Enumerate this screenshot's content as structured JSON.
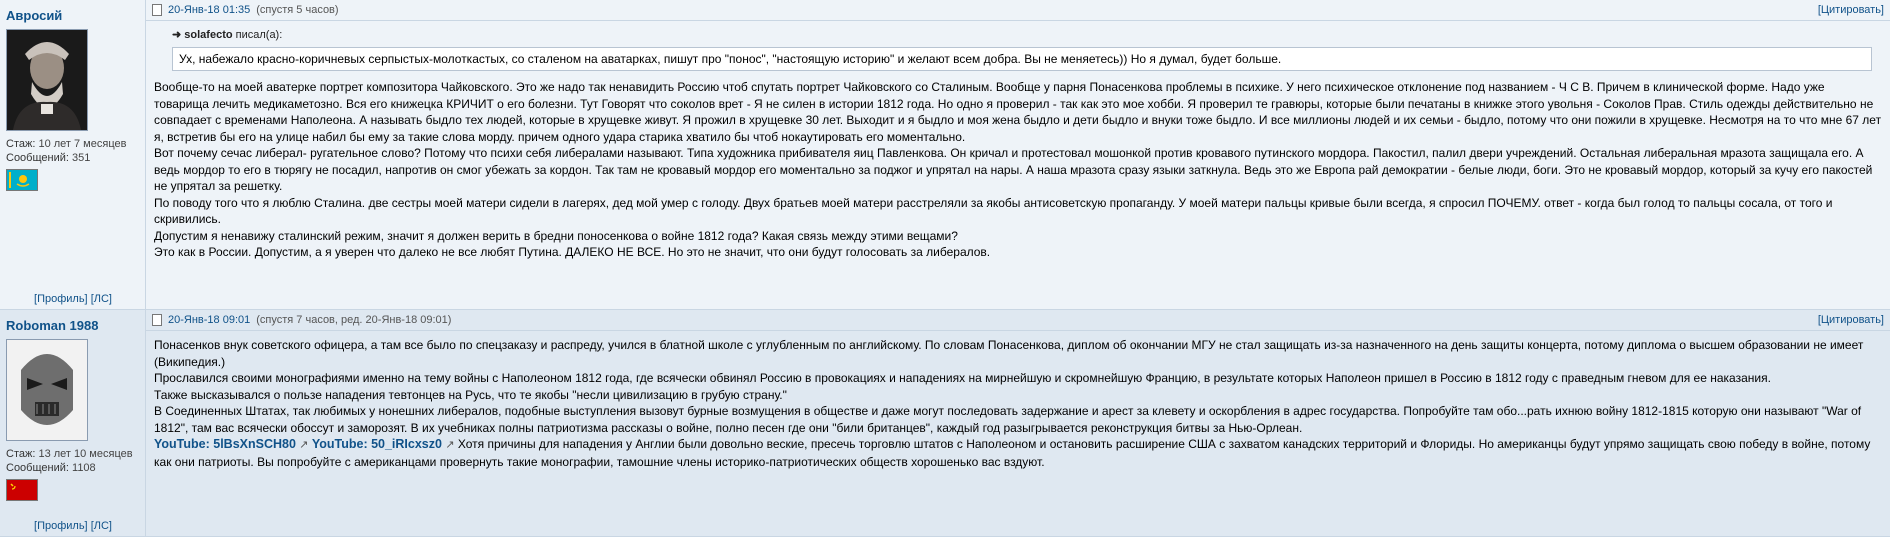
{
  "posts": [
    {
      "author": "Авросий",
      "stats": {
        "tenure_label": "Стаж:",
        "tenure": "10 лет 7 месяцев",
        "posts_label": "Сообщений:",
        "posts": "351"
      },
      "links": {
        "profile": "[Профиль]",
        "pm": "[ЛС]"
      },
      "date": "20-Янв-18 01:35",
      "since": "(спустя 5 часов)",
      "quote_button": "[Цитировать]",
      "quote": {
        "author": "solafecto",
        "verb": "писал(а):",
        "text": "Ух, набежало красно-коричневых серпыстых-молоткастых, со сталеном на аватарках, пишут про \"понос\", \"настоящую историю\" и желают всем добра. Вы не меняетесь)) Но я думал, будет больше."
      },
      "paragraphs": [
        "Вообще-то на моей аватерке портрет композитора Чайковского. Это же надо так ненавидить Россию чтоб спутать портрет Чайковского со Сталиным. Вообще у парня Понасенкова проблемы в психике. У него психическое отклонение под названием - Ч С В. Причем в клинической форме. Надо уже товарища лечить медикаметозно. Вся его книжецка КРИЧИТ о его болезни. Тут Говорят что соколов врет - Я не силен в истории 1812 года. Но одно я проверил - так как это мое хобби. Я проверил те гравюры, которые были печатаны в книжке этого увольня - Соколов Прав. Стиль одежды действительно не совпадает с временами Наполеона. А называть быдло тех людей, которые в хрущевке живут. Я прожил в хрущевке 30 лет. Выходит и я быдло и моя жена быдло и дети быдло и внуки тоже быдло. И все миллионы людей и их семьи - быдло, потому что они пожили в хрущевке. Несмотря на то что мне 67 лет я, встретив бы его на улице набил бы ему за такие слова морду. причем одного удара старика хватило бы чтоб нокаутировать его моментально.",
        "Вот почему сечас либерал- ругательное слово? Потому что психи себя либералами называют. Типа художника прибивателя яиц Павленкова. Он кричал и протестовал мошонкой против кровавого путинского мордора. Пакостил, палил двери учреждений. Остальная либеральная мразота защищала его. А ведь мордор то его в тюрягу не посадил, напротив он смог убежать за кордон. Так там не кровавый мордор его моментально за поджог и упрятал на нары. А наша мразота сразу языки заткнула. Ведь это же Европа рай демократии - белые люди, боги. Это не кровавый мордор, который за кучу его пакостей не упрятал за решетку.",
        "По поводу того что я люблю Сталина. две сестры моей матери сидели в лагерях, дед мой умер с голоду. Двух братьев моей матери расстреляли за якобы антисоветскую пропаганду. У моей матери пальцы кривые были всегда, я спросил ПОЧЕМУ. ответ - когда был голод то пальцы сосала, от того и скривились.",
        "Допустим я ненавижу сталинский режим, значит я должен верить в бредни поносенкова о войне 1812 года? Какая связь между этими вещами?",
        "Это как в России. Допустим, а я уверен что далеко не все любят Путина. ДАЛЕКО НЕ ВСЕ. Но это не значит, что они будут голосовать за либералов."
      ]
    },
    {
      "author": "Roboman 1988",
      "stats": {
        "tenure_label": "Стаж:",
        "tenure": "13 лет 10 месяцев",
        "posts_label": "Сообщений:",
        "posts": "1108"
      },
      "links": {
        "profile": "[Профиль]",
        "pm": "[ЛС]"
      },
      "date": "20-Янв-18 09:01",
      "since": "(спустя 7 часов, ред. 20-Янв-18 09:01)",
      "quote_button": "[Цитировать]",
      "paragraphs": [
        "Понасенков внук советского офицера, а там все было по спецзаказу и распреду, учился в блатной школе с углубленным по английскому. По словам Понасенкова, диплом об окончании МГУ не стал защищать из-за назначенного на день защиты концерта, потому диплома о высшем образовании не имеет (Википедия.)",
        "Прославился своими монографиями именно на тему войны с Наполеоном 1812 года, где всячески обвинял Россию в провокациях и нападениях на мирнейшую и скромнейшую Францию, в результате которых Наполеон пришел в Россию в 1812 году с праведным гневом для ее наказания.",
        "Также высказывался о пользе нападения тевтонцев на Русь, что те якобы \"несли цивилизацию в грубую страну.\"",
        "В Соединенных Штатах, так любимых у нонешних либералов, подобные выступления вызовут бурные возмущения в обществе и даже могут последовать задержание и арест за клевету и оскорбления в адрес государства. Попробуйте там обо...рать ихнюю войну 1812-1815 которую они называют \"War of 1812\", там вас всячески обоссут и заморозят. В их учебниках полны патриотизма рассказы о войне, полно песен где они \"били британцев\", каждый год разыгрывается реконструкция битвы за Нью-Орлеан."
      ],
      "youtube": [
        {
          "label": "YouTube: 5lBsXnSCH80"
        },
        {
          "label": "YouTube: 50_iRIcxsz0"
        }
      ],
      "tail": "Хотя причины для нападения у Англии были довольно веские, пресечь торговлю штатов с Наполеоном и остановить расширение США с захватом канадских территорий и Флориды. Но американцы будут упрямо защищать свою победу в войне, потому как они патриоты. Вы попробуйте с американцами провернуть такие монографии, тамошние члены историко-патриотических обществ хорошенько вас вздуют."
    }
  ],
  "icons": {
    "post": "doc-icon",
    "external": "external-link-icon",
    "flag1": "kazakhstan-flag",
    "flag2": "ussr-flag"
  },
  "colors": {
    "link": "#105289",
    "row1": "#eef3f8",
    "row2": "#dfe8f1"
  }
}
